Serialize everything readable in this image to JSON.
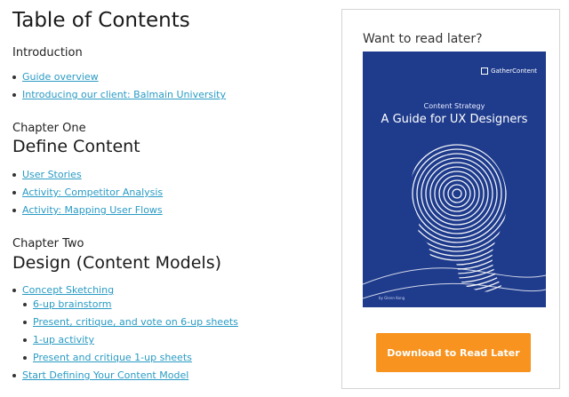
{
  "toc": {
    "title": "Table of Contents",
    "introduction": {
      "label": "Introduction",
      "items": [
        "Guide overview",
        "Introducing our client: Balmain University"
      ]
    },
    "chapter_one": {
      "label": "Chapter One",
      "title": "Define Content",
      "items": [
        "User Stories",
        "Activity: Competitor Analysis",
        "Activity: Mapping User Flows"
      ]
    },
    "chapter_two": {
      "label": "Chapter Two",
      "title": "Design (Content Models)",
      "items": [
        "Concept Sketching",
        "6-up brainstorm",
        "Present, critique, and vote on 6-up sheets",
        "1-up activity",
        "Present and critique 1-up sheets",
        "Start Defining Your Content Model"
      ]
    }
  },
  "promo": {
    "heading": "Want to read later?",
    "cover": {
      "brand": "GatherContent",
      "kicker": "Content Strategy",
      "title": "A Guide for UX Designers",
      "author": "by Glenn Kong"
    },
    "button_label": "Download to Read Later"
  },
  "colors": {
    "link": "#2a9bc4",
    "cover_blue": "#1e3b8c",
    "button_orange": "#f7931e"
  }
}
